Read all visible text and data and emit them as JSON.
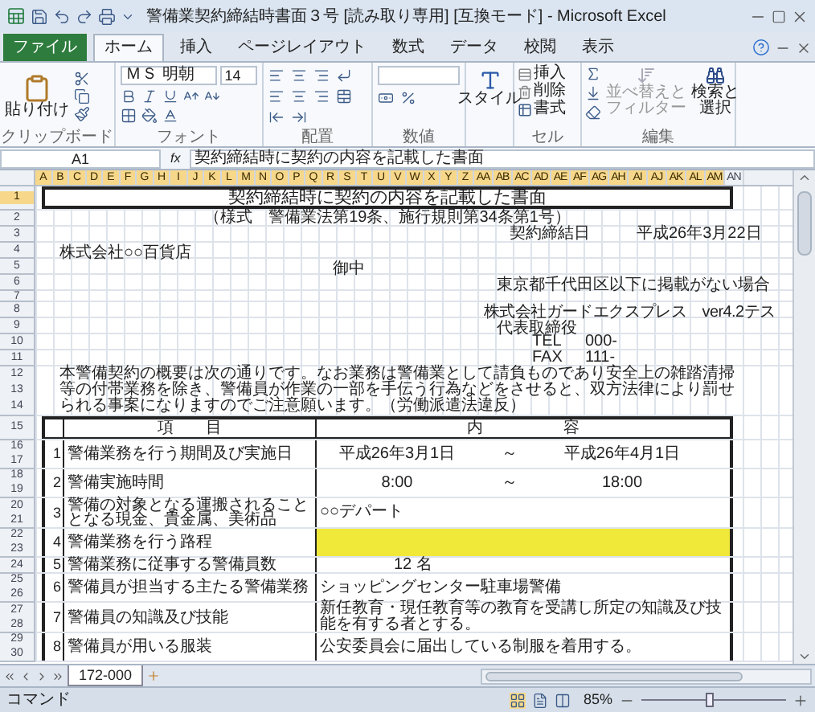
{
  "window": {
    "title": "警備業契約締結時書面３号 [読み取り専用] [互換モード] - Microsoft Excel"
  },
  "ribbon_tabs": [
    {
      "label": "ファイル",
      "kind": "file",
      "selected": false
    },
    {
      "label": "ホーム",
      "kind": "tab",
      "selected": true
    },
    {
      "label": "挿入",
      "kind": "tab",
      "selected": false
    },
    {
      "label": "ページレイアウト",
      "kind": "tab",
      "selected": false
    },
    {
      "label": "数式",
      "kind": "tab",
      "selected": false
    },
    {
      "label": "データ",
      "kind": "tab",
      "selected": false
    },
    {
      "label": "校閲",
      "kind": "tab",
      "selected": false
    },
    {
      "label": "表示",
      "kind": "tab",
      "selected": false
    }
  ],
  "ribbon": {
    "clipboard": {
      "paste": "貼り付け",
      "group": "クリップボード"
    },
    "font": {
      "name": "ＭＳ 明朝",
      "size": "14",
      "group": "フォント"
    },
    "alignment": {
      "group": "配置"
    },
    "number": {
      "group": "数値"
    },
    "styles": {
      "button": "スタイル"
    },
    "cells": {
      "insert": "挿入",
      "delete": "削除",
      "format": "書式",
      "group": "セル"
    },
    "editing": {
      "sort_filter": [
        "並べ替えと",
        "フィルター"
      ],
      "find_select": [
        "検索と",
        "選択"
      ],
      "group": "編集"
    }
  },
  "formula_bar": {
    "cell": "A1",
    "fx": "fx",
    "value": "契約締結時に契約の内容を記載した書面"
  },
  "columns": [
    {
      "label": "A",
      "selected": true
    },
    {
      "label": "B",
      "selected": true
    },
    {
      "label": "C",
      "selected": true
    },
    {
      "label": "D",
      "selected": true
    },
    {
      "label": "E",
      "selected": true
    },
    {
      "label": "F",
      "selected": true
    },
    {
      "label": "G",
      "selected": true
    },
    {
      "label": "H",
      "selected": true
    },
    {
      "label": "I",
      "selected": true
    },
    {
      "label": "J",
      "selected": true
    },
    {
      "label": "K",
      "selected": true
    },
    {
      "label": "L",
      "selected": true
    },
    {
      "label": "M",
      "selected": true
    },
    {
      "label": "N",
      "selected": true
    },
    {
      "label": "O",
      "selected": true
    },
    {
      "label": "P",
      "selected": true
    },
    {
      "label": "Q",
      "selected": true
    },
    {
      "label": "R",
      "selected": true
    },
    {
      "label": "S",
      "selected": true
    },
    {
      "label": "T",
      "selected": true
    },
    {
      "label": "U",
      "selected": true
    },
    {
      "label": "V",
      "selected": true
    },
    {
      "label": "W",
      "selected": true
    },
    {
      "label": "X",
      "selected": true
    },
    {
      "label": "Y",
      "selected": true
    },
    {
      "label": "Z",
      "selected": true
    },
    {
      "label": "AA",
      "selected": true
    },
    {
      "label": "AB",
      "selected": true
    },
    {
      "label": "AC",
      "selected": true
    },
    {
      "label": "AD",
      "selected": true
    },
    {
      "label": "AE",
      "selected": true
    },
    {
      "label": "AF",
      "selected": true
    },
    {
      "label": "AG",
      "selected": true
    },
    {
      "label": "AH",
      "selected": true
    },
    {
      "label": "AI",
      "selected": true
    },
    {
      "label": "AJ",
      "selected": true
    },
    {
      "label": "AK",
      "selected": true
    },
    {
      "label": "AL",
      "selected": true
    },
    {
      "label": "AM",
      "selected": true
    },
    {
      "label": "AN",
      "selected": false
    }
  ],
  "rows": [
    {
      "number": "1",
      "selected": true
    },
    {
      "number": "2",
      "selected": false
    },
    {
      "number": "3",
      "selected": false
    },
    {
      "number": "4",
      "selected": false
    },
    {
      "number": "5",
      "selected": false
    },
    {
      "number": "6",
      "selected": false
    },
    {
      "number": "7",
      "selected": false
    },
    {
      "number": "8",
      "selected": false
    },
    {
      "number": "9",
      "selected": false
    },
    {
      "number": "10",
      "selected": false
    },
    {
      "number": "11",
      "selected": false
    },
    {
      "number": "12",
      "selected": false
    },
    {
      "number": "13",
      "selected": false
    },
    {
      "number": "14",
      "selected": false
    },
    {
      "number": "15",
      "selected": false
    },
    {
      "number": "16",
      "selected": false
    },
    {
      "number": "17",
      "selected": false
    },
    {
      "number": "18",
      "selected": false
    },
    {
      "number": "19",
      "selected": false
    },
    {
      "number": "20",
      "selected": false
    },
    {
      "number": "21",
      "selected": false
    },
    {
      "number": "22",
      "selected": false
    },
    {
      "number": "23",
      "selected": false
    },
    {
      "number": "24",
      "selected": false
    },
    {
      "number": "25",
      "selected": false
    },
    {
      "number": "26",
      "selected": false
    },
    {
      "number": "27",
      "selected": false
    },
    {
      "number": "28",
      "selected": false
    },
    {
      "number": "29",
      "selected": false
    },
    {
      "number": "30",
      "selected": false
    }
  ],
  "sheet": {
    "title": "契約締結時に契約の内容を記載した書面",
    "subtitle": "（様式　警備業法第19条、施行規則第34条第1号）",
    "contract_date_label": "契約締結日",
    "contract_date": "平成26年3月22日",
    "client": "株式会社○○百貨店",
    "honorific": "御中",
    "address": "東京都千代田区以下に掲載がない場合",
    "company": "株式会社ガードエクスプレス　ver4.2テス",
    "representative": "代表取締役",
    "contacts": [
      {
        "label": "TEL",
        "value": "000-"
      },
      {
        "label": "FAX",
        "value": "111-"
      }
    ],
    "notice": "本警備契約の概要は次の通りです。なお業務は警備業として請負ものであり安全上の雑踏清掃等の付帯業務を除き、警備員が作業の一部を手伝う行為などをさせると、双方法律により罰せられる事案になりますのでご注意願います。（労働派遣法違反）",
    "table": {
      "columns": [
        "項　　目",
        "内　　　　　容"
      ],
      "items": [
        {
          "no": "1",
          "label": "警備業務を行う期間及び実施日",
          "kind": "range",
          "from": "平成26年3月1日",
          "separator": "～",
          "to": "平成26年4月1日",
          "highlighted": false
        },
        {
          "no": "2",
          "label": "警備実施時間",
          "kind": "range",
          "from": "8:00",
          "separator": "～",
          "to": "18:00",
          "highlighted": false
        },
        {
          "no": "3",
          "label": "警備の対象となる運搬されることとなる現金、貴金属、美術品",
          "kind": "text",
          "value": "○○デパート",
          "highlighted": false
        },
        {
          "no": "4",
          "label": "警備業務を行う路程",
          "kind": "text",
          "highlighted": true
        },
        {
          "no": "5",
          "label": "警備業務に従事する警備員数",
          "kind": "text",
          "value": "12 名",
          "highlighted": false
        },
        {
          "no": "6",
          "label": "警備員が担当する主たる警備業務",
          "kind": "text",
          "value": "ショッピングセンター駐車場警備",
          "highlighted": false
        },
        {
          "no": "7",
          "label": "警備員の知識及び技能",
          "kind": "text",
          "value": "新任教育・現任教育等の教育を受講し所定の知識及び技能を有する者とする。",
          "highlighted": false
        },
        {
          "no": "8",
          "label": "警備員が用いる服装",
          "kind": "text",
          "value": "公安委員会に届出している制服を着用する。",
          "highlighted": false
        }
      ]
    }
  },
  "sheet_tabs": [
    {
      "label": "172-000",
      "selected": true
    }
  ],
  "status_bar": {
    "mode": "コマンド",
    "zoom": "85%",
    "zoom_slider": {
      "level": 0.47
    }
  }
}
